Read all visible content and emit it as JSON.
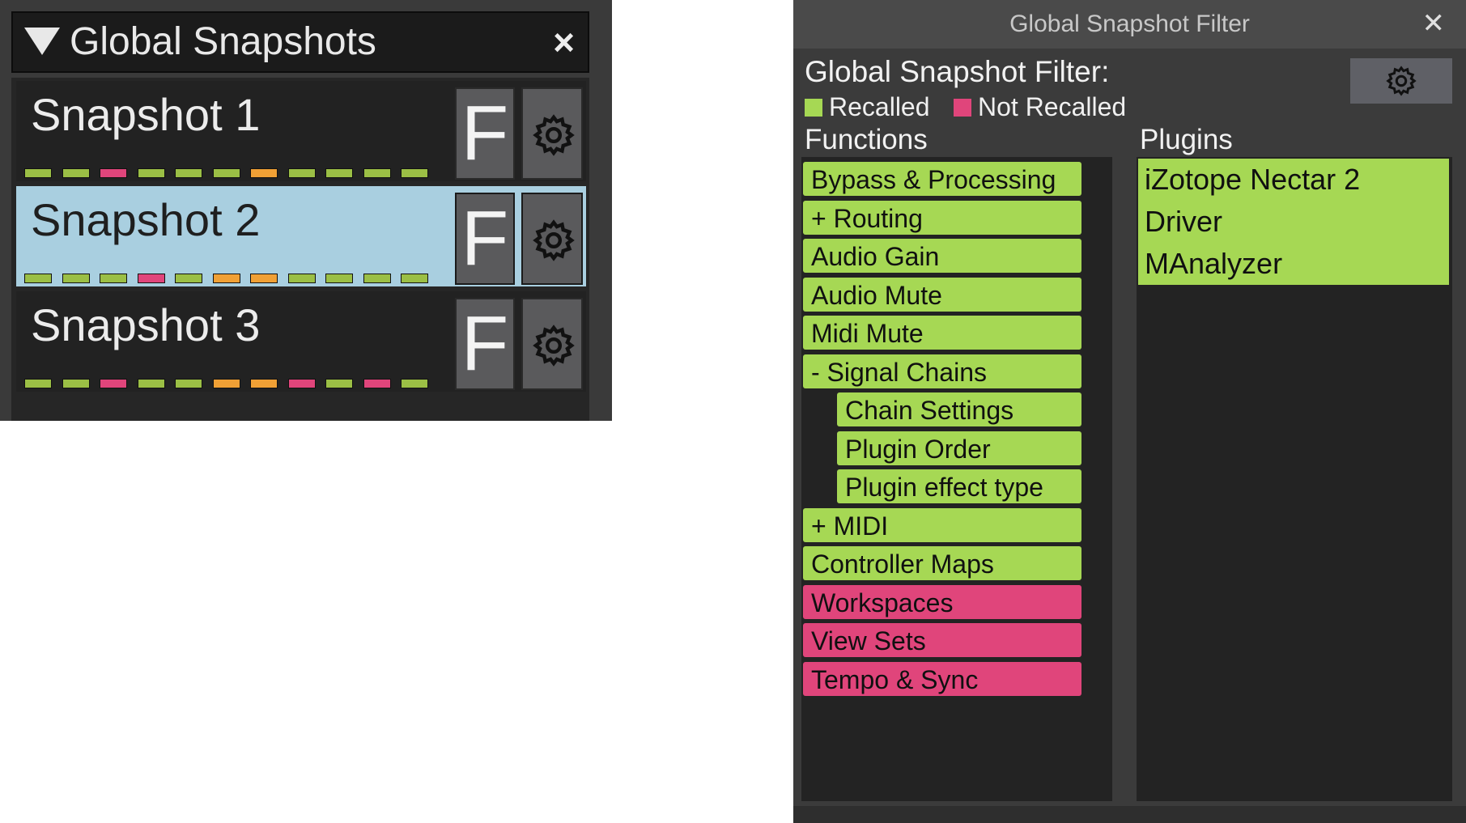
{
  "snapshots_panel": {
    "title": "Global Snapshots",
    "close_label": "×",
    "icons": {
      "collapse": "triangle-down-icon",
      "close": "close-icon",
      "settings": "gear-icon"
    },
    "snapshots": [
      {
        "name": "Snapshot 1",
        "selected": false,
        "f_label": "F",
        "leds": [
          "green",
          "green",
          "pink",
          "green",
          "green",
          "green",
          "orange",
          "green",
          "green",
          "green",
          "green"
        ]
      },
      {
        "name": "Snapshot 2",
        "selected": true,
        "f_label": "F",
        "leds": [
          "green",
          "green",
          "green",
          "pink",
          "green",
          "orange",
          "orange",
          "green",
          "green",
          "green",
          "green"
        ]
      },
      {
        "name": "Snapshot 3",
        "selected": false,
        "f_label": "F",
        "leds": [
          "green",
          "green",
          "pink",
          "green",
          "green",
          "orange",
          "orange",
          "pink",
          "green",
          "pink",
          "green"
        ]
      }
    ]
  },
  "filter_window": {
    "window_title": "Global Snapshot Filter",
    "close_label": "✕",
    "heading": "Global Snapshot Filter:",
    "legend": [
      {
        "label": "Recalled",
        "color": "#a6d854"
      },
      {
        "label": "Not Recalled",
        "color": "#e0457b"
      }
    ],
    "functions_title": "Functions",
    "plugins_title": "Plugins",
    "functions": [
      {
        "label": "Bypass & Processing",
        "state": "recalled",
        "indent": 0
      },
      {
        "label": "+  Routing",
        "state": "recalled",
        "indent": 0
      },
      {
        "label": "Audio Gain",
        "state": "recalled",
        "indent": 0
      },
      {
        "label": "Audio Mute",
        "state": "recalled",
        "indent": 0
      },
      {
        "label": "Midi Mute",
        "state": "recalled",
        "indent": 0
      },
      {
        "label": "-  Signal Chains",
        "state": "recalled",
        "indent": 0
      },
      {
        "label": "Chain Settings",
        "state": "recalled",
        "indent": 1
      },
      {
        "label": "Plugin Order",
        "state": "recalled",
        "indent": 1
      },
      {
        "label": "Plugin effect type",
        "state": "recalled",
        "indent": 1
      },
      {
        "label": "+  MIDI",
        "state": "recalled",
        "indent": 0
      },
      {
        "label": "Controller Maps",
        "state": "recalled",
        "indent": 0
      },
      {
        "label": "Workspaces",
        "state": "not_recalled",
        "indent": 0
      },
      {
        "label": "View Sets",
        "state": "not_recalled",
        "indent": 0
      },
      {
        "label": "Tempo & Sync",
        "state": "not_recalled",
        "indent": 0
      }
    ],
    "plugins": [
      {
        "label": "iZotope Nectar 2"
      },
      {
        "label": "Driver"
      },
      {
        "label": "MAnalyzer"
      }
    ]
  },
  "colors": {
    "green": "#9bbf45",
    "green_light": "#a6d854",
    "pink": "#e0457b",
    "orange": "#f0a035",
    "selected_row": "#a9cfe0"
  }
}
